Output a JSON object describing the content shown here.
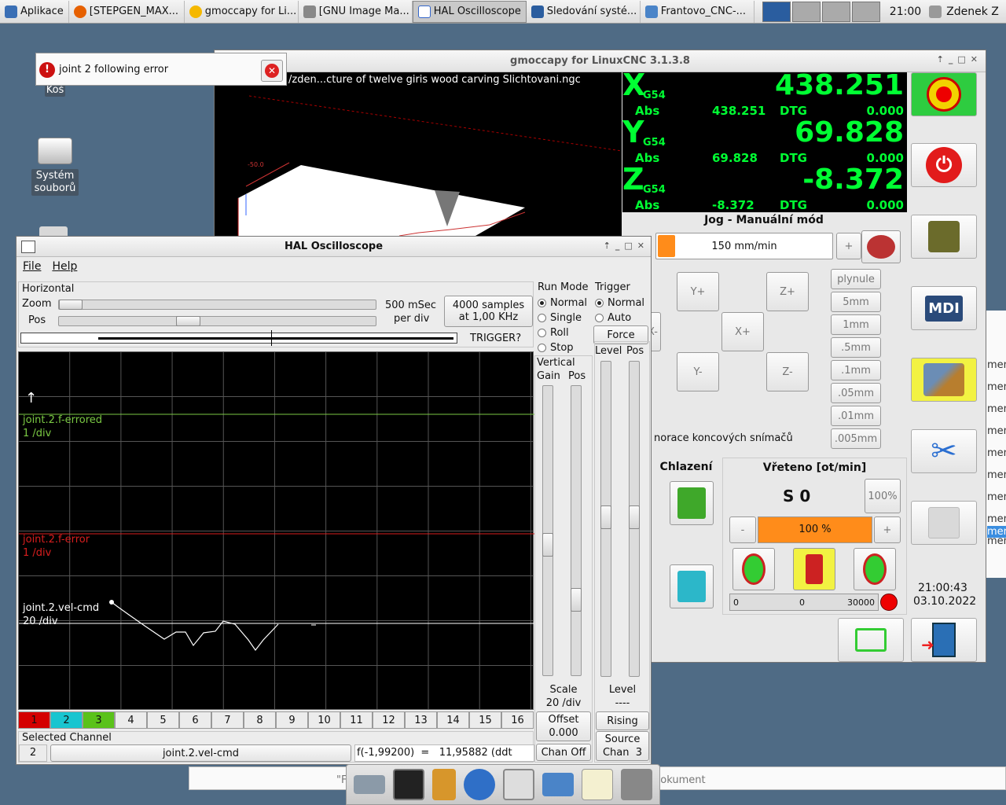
{
  "taskbar": {
    "apps_label": "Aplikace",
    "items": [
      {
        "label": "[STEPGEN_MAX...",
        "icon": "firefox-icon"
      },
      {
        "label": "gmoccapy for Li...",
        "icon": "gmoccapy-icon"
      },
      {
        "label": "[GNU Image Ma...",
        "icon": "gimp-icon"
      },
      {
        "label": "HAL Oscilloscope",
        "icon": "window-icon"
      },
      {
        "label": "Sledování systé...",
        "icon": "monitor-icon"
      },
      {
        "label": "Frantovo_CNC-...",
        "icon": "folder-icon"
      }
    ],
    "clock": "21:00",
    "user": "Zdenek Z"
  },
  "desktop": {
    "icons": [
      {
        "label": "Koš"
      },
      {
        "label": "Systém souborů"
      }
    ]
  },
  "notification": {
    "text": "joint 2 following error"
  },
  "gmoccapy": {
    "title": "gmoccapy for LinuxCNC  3.1.3.8",
    "file_path": "/zden...cture of twelve giris wood carving Slichtovani.ngc",
    "dro": [
      {
        "axis": "X",
        "coord": "G54",
        "value": "438.251",
        "abs_label": "Abs",
        "abs": "438.251",
        "dtg_label": "DTG",
        "dtg": "0.000"
      },
      {
        "axis": "Y",
        "coord": "G54",
        "value": "69.828",
        "abs_label": "Abs",
        "abs": "69.828",
        "dtg_label": "DTG",
        "dtg": "0.000"
      },
      {
        "axis": "Z",
        "coord": "G54",
        "value": "-8.372",
        "abs_label": "Abs",
        "abs": "-8.372",
        "dtg_label": "DTG",
        "dtg": "0.000"
      }
    ],
    "jog_title": "Jog - Manuální mód",
    "jog_speed": "150 mm/min",
    "jog_plus": "+",
    "jog_buttons": {
      "yplus": "Y+",
      "zplus": "Z+",
      "xminus": "X-",
      "xplus": "X+",
      "yminus": "Y-",
      "zminus": "Z-"
    },
    "increments": [
      "plynule",
      "5mm",
      "1mm",
      ".5mm",
      ".1mm",
      ".05mm",
      ".01mm",
      ".005mm"
    ],
    "ignore_limits": "norace koncových snímačů",
    "coolant_title": "Chlazení",
    "spindle_title": "Vřeteno [ot/min]",
    "spindle_speed": "S 0",
    "spindle_override": "100%",
    "spindle_minus": "-",
    "spindle_plus": "+",
    "spindle_bar": "100 %",
    "spindle_bar_pct": 100,
    "spindle_min": "0",
    "spindle_cur": "0",
    "spindle_max": "30000",
    "time": "21:00:43",
    "date": "03.10.2022",
    "mdi_label": "MDI",
    "colors": {
      "dro_green": "#00ff33",
      "orange": "#ff8c1a",
      "yellow": "#f2f242",
      "estop_green": "#2ecc40"
    }
  },
  "scope": {
    "title": "HAL Oscilloscope",
    "menu": [
      "File",
      "Help"
    ],
    "horizontal": {
      "label": "Horizontal",
      "zoom": "Zoom",
      "pos": "Pos",
      "rate": "500 mSec",
      "per_div": "per div",
      "samples": "4000 samples",
      "freq": "at 1,00 KHz",
      "trigger_status": "TRIGGER?"
    },
    "run_mode": {
      "label": "Run Mode",
      "options": [
        "Normal",
        "Single",
        "Roll",
        "Stop"
      ],
      "selected": 0
    },
    "trigger": {
      "label": "Trigger",
      "options": [
        "Normal",
        "Auto"
      ],
      "selected": 0,
      "force": "Force",
      "level": "Level",
      "pos": "Pos"
    },
    "vertical": {
      "label": "Vertical",
      "gain": "Gain",
      "pos": "Pos",
      "scale_label": "Scale",
      "scale": "20 /div",
      "offset_label": "Offset",
      "offset": "0.000",
      "chan_off": "Chan Off"
    },
    "trig_side": {
      "level_label": "Level",
      "level": "----",
      "rising": "Rising",
      "source_label": "Source",
      "source": "Chan  3"
    },
    "traces": [
      {
        "name": "joint.2.f-errored",
        "scale": "1 /div",
        "color": "#7ac943"
      },
      {
        "name": "joint.2.f-error",
        "scale": "1 /div",
        "color": "#d81e1e"
      },
      {
        "name": "joint.2.vel-cmd",
        "scale": "20 /div",
        "color": "#ffffff"
      }
    ],
    "channels": [
      "1",
      "2",
      "3",
      "4",
      "5",
      "6",
      "7",
      "8",
      "9",
      "10",
      "11",
      "12",
      "13",
      "14",
      "15",
      "16"
    ],
    "channel_colors": [
      "#d40000",
      "#18c5d0",
      "#5ac21a"
    ],
    "selected_channel_label": "Selected Channel",
    "selected_channel": "2",
    "selected_channel_name": "joint.2.vel-cmd",
    "readout": "f(-1,99200)  =   11,95882 (ddt"
  },
  "background_text": {
    "dokument": "dokument",
    "quote": "\"F",
    "right_list": [
      "ment",
      "ment",
      "ment",
      "ment",
      "ment",
      "ment",
      "ment",
      "ment",
      "ment",
      "ment"
    ]
  }
}
